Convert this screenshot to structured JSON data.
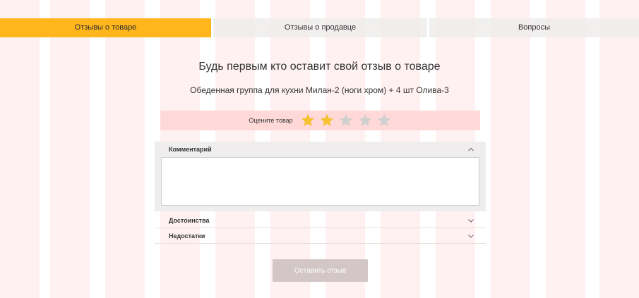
{
  "tabs": [
    {
      "label": "Отзывы о товаре",
      "active": true
    },
    {
      "label": "Отзывы о продавце",
      "active": false
    },
    {
      "label": "Вопросы",
      "active": false
    }
  ],
  "review": {
    "title": "Будь первым кто оставит свой отзыв о товаре",
    "product_name": "Обеденная группа для кухни Милан-2 (ноги хром) + 4 шт Олива-3"
  },
  "rating": {
    "label": "Оцените товар",
    "value": 2,
    "max": 5,
    "filled_color": "#f5c230",
    "empty_color": "#cfcfcf"
  },
  "accordion": {
    "comment": {
      "label": "Комментарий",
      "expanded": true,
      "value": ""
    },
    "pros": {
      "label": "Достоинства",
      "expanded": false
    },
    "cons": {
      "label": "Недостатки",
      "expanded": false
    }
  },
  "submit": {
    "label": "Оставить отзыв"
  },
  "colors": {
    "accent": "#ffb61d",
    "rating_bar_bg": "#ffd8d8",
    "button_bg": "#d2c6c6"
  },
  "icons": {
    "star": "star-icon",
    "chevron_up": "chevron-up-icon",
    "chevron_down": "chevron-down-icon"
  }
}
